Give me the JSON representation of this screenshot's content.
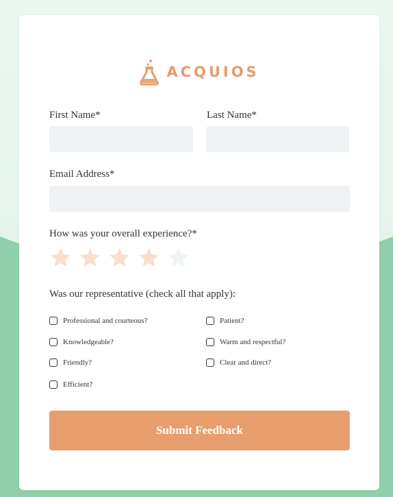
{
  "brand": {
    "name": "ACQUIOS",
    "accent_color": "#e89e6c",
    "icon": "flask-icon"
  },
  "form": {
    "first_name": {
      "label": "First Name*",
      "value": ""
    },
    "last_name": {
      "label": "Last Name*",
      "value": ""
    },
    "email": {
      "label": "Email Address*",
      "value": ""
    },
    "rating": {
      "label": "How was your overall experience?*",
      "value": 4,
      "max": 5
    },
    "representative": {
      "label": "Was our representative (check all that apply):",
      "options": [
        {
          "label": "Professional and courteous?",
          "checked": false
        },
        {
          "label": "Patient?",
          "checked": false
        },
        {
          "label": "Knowledgeable?",
          "checked": false
        },
        {
          "label": "Warm and respectful?",
          "checked": false
        },
        {
          "label": "Friendly?",
          "checked": false
        },
        {
          "label": "Clear and direct?",
          "checked": false
        },
        {
          "label": "Efficient?",
          "checked": false
        }
      ]
    },
    "submit_label": "Submit Feedback"
  },
  "colors": {
    "field_bg": "#eef2f5",
    "star_filled": "#f8dfcf",
    "star_empty": "#eef3f7",
    "page_green": "#8fd0ab"
  }
}
